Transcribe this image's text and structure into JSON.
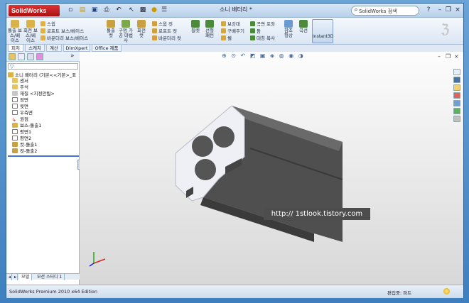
{
  "app": {
    "logo": "SolidWorks",
    "document_title": "소니 배터리 *",
    "search_placeholder": "SolidWorks 검색",
    "help": "?",
    "minimize": "–",
    "restore": "❐",
    "close": "×"
  },
  "ribbon": {
    "col1": [
      "돌출 보스/베이스",
      "회전 보스/베이스"
    ],
    "col2": [
      "스윕",
      "로프트 보스/베이스",
      "바운더리 보스/베이스"
    ],
    "col3": [
      "돌출 컷",
      "구멍 가공 마법사",
      "회전 컷"
    ],
    "col4": [
      "스윕 컷",
      "로프트 컷",
      "바운더리 컷"
    ],
    "fillet": "필렛",
    "pattern": "선형 패턴",
    "col7": [
      "보강대",
      "구배주기",
      "쉘"
    ],
    "col8": [
      "곡면 포장",
      "돔",
      "대칭 복사"
    ],
    "refgeom": "참조 형상",
    "curves": "곡선",
    "instant3d": "Instant3D"
  },
  "tabs": [
    "피처",
    "스케치",
    "계산",
    "DimXpert",
    "Office 제품"
  ],
  "tree": {
    "filter": "▽",
    "root": "소니 배터리 (기본<<기본>_표",
    "items": [
      "센서",
      "주석",
      "재질 <지정안됨>",
      "정면",
      "윗면",
      "우측면",
      "원점",
      "보스-돌출1",
      "평면1",
      "평면2",
      "컷-돌출1",
      "컷-돌출2"
    ]
  },
  "bottom_tabs": [
    "모델",
    "모션 스터디 1"
  ],
  "viewport": {
    "hud_icons": [
      "zoom-fit-icon",
      "zoom-area-icon",
      "previous-view-icon",
      "section-view-icon",
      "view-orientation-icon",
      "display-style-icon",
      "hide-show-icon",
      "appearance-icon",
      "scene-icon"
    ],
    "watermark": "http:// 1stlook.tistory.com"
  },
  "status": {
    "edition": "SolidWorks Premium 2010 x64 Edition",
    "mode": "편집중: 파트"
  },
  "colors": {
    "accent": "#3e7fbf",
    "model_side": "#4c4c4c",
    "model_face": "#eef0f6"
  }
}
